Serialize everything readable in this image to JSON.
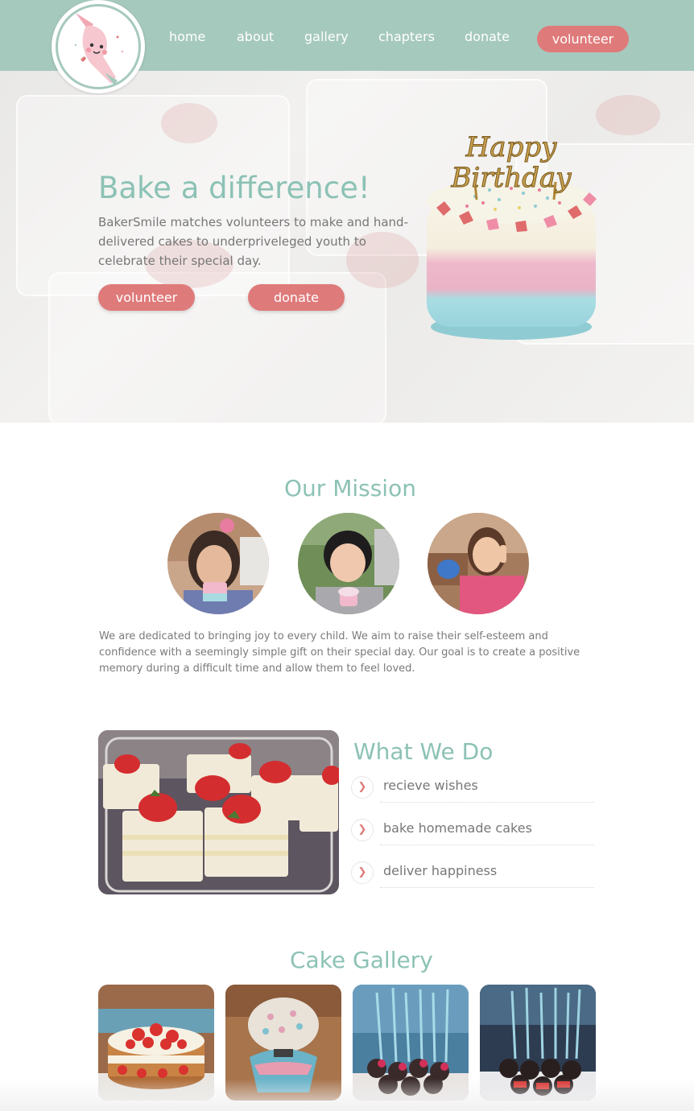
{
  "header": {
    "logo_icon": "piping-bag-logo-icon",
    "nav": [
      {
        "label": "home"
      },
      {
        "label": "about"
      },
      {
        "label": "gallery"
      },
      {
        "label": "chapters"
      },
      {
        "label": "donate"
      }
    ],
    "cta_label": "volunteer"
  },
  "hero": {
    "title": "Bake a difference!",
    "text": "BakerSmile matches volunteers to make and hand-delivered cakes to underpriveleged youth to celebrate their special day.",
    "volunteer_label": "volunteer",
    "donate_label": "donate",
    "cake_topper_line1": "Happy",
    "cake_topper_line2": "Birthday"
  },
  "mission": {
    "title": "Our Mission",
    "text": "We are dedicated to bringing joy to every child. We aim to raise their self-esteem and confidence with a seemingly simple gift on their special day. Our goal is to create a positive memory during a difficult time and allow them to feel loved."
  },
  "what_we_do": {
    "title": "What We Do",
    "items": [
      {
        "label": "recieve wishes",
        "icon": "chevron-right-icon"
      },
      {
        "label": "bake homemade cakes",
        "icon": "chevron-right-icon"
      },
      {
        "label": "deliver happiness",
        "icon": "chevron-right-icon"
      }
    ]
  },
  "gallery": {
    "title": "Cake Gallery"
  },
  "colors": {
    "header_bg": "#a6c9bd",
    "accent_teal": "#8cc2b5",
    "button_pink": "#df7a7a"
  }
}
